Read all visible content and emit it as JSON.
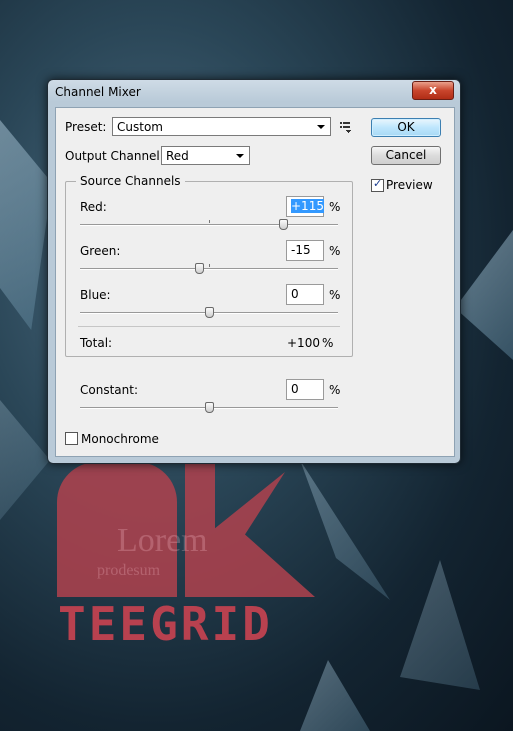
{
  "window": {
    "title": "Channel Mixer",
    "close_label": "x"
  },
  "preset": {
    "label": "Preset:",
    "value": "Custom"
  },
  "output_channel": {
    "label": "Output Channel:",
    "value": "Red"
  },
  "buttons": {
    "ok": "OK",
    "cancel": "Cancel"
  },
  "preview": {
    "label": "Preview",
    "checked": true
  },
  "source_channels": {
    "legend": "Source Channels",
    "red": {
      "label": "Red:",
      "value": "+115",
      "unit": "%",
      "slider": 115
    },
    "green": {
      "label": "Green:",
      "value": "-15",
      "unit": "%",
      "slider": -15
    },
    "blue": {
      "label": "Blue:",
      "value": "0",
      "unit": "%",
      "slider": 0
    },
    "total": {
      "label": "Total:",
      "value": "+100",
      "unit": "%"
    }
  },
  "constant": {
    "label": "Constant:",
    "value": "0",
    "unit": "%",
    "slider": 0
  },
  "monochrome": {
    "label": "Monochrome",
    "checked": false
  },
  "background": {
    "logo_text": "TEEGRID",
    "faint_text": "Lorem",
    "faint_text_2": "prodesum"
  },
  "colors": {
    "accent": "#3399ff",
    "logo": "#b8414f",
    "close": "#c9452c"
  },
  "icons": {
    "menu": "list-menu-icon",
    "check": "checkmark-icon"
  }
}
